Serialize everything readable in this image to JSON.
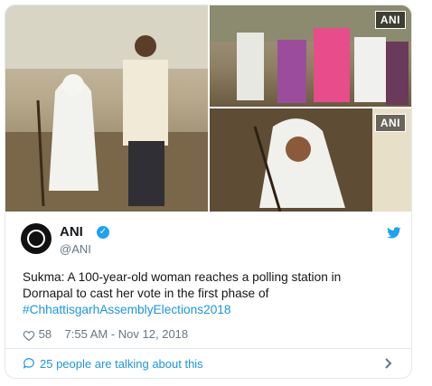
{
  "media": {
    "watermarks": [
      "ANI",
      "ANI"
    ]
  },
  "tweet": {
    "author_name": "ANI",
    "author_handle": "@ANI",
    "text_line1": "Sukma: A 100-year-old woman reaches a polling station in",
    "text_line2": "Dornapal to cast her vote in the first phase of",
    "hashtag": "#ChhattisgarhAssemblyElections2018",
    "likes": "58",
    "timestamp": "7:55 AM - Nov 12, 2018"
  },
  "footer": {
    "conversation_text": "25 people are talking about this"
  },
  "colors": {
    "accent": "#1da1f2",
    "link": "#1b95e0",
    "muted": "#657786",
    "border": "#e1e8ed"
  },
  "icons": [
    "verified-icon",
    "twitter-bird-icon",
    "heart-icon",
    "speech-bubble-icon",
    "chevron-right-icon"
  ]
}
